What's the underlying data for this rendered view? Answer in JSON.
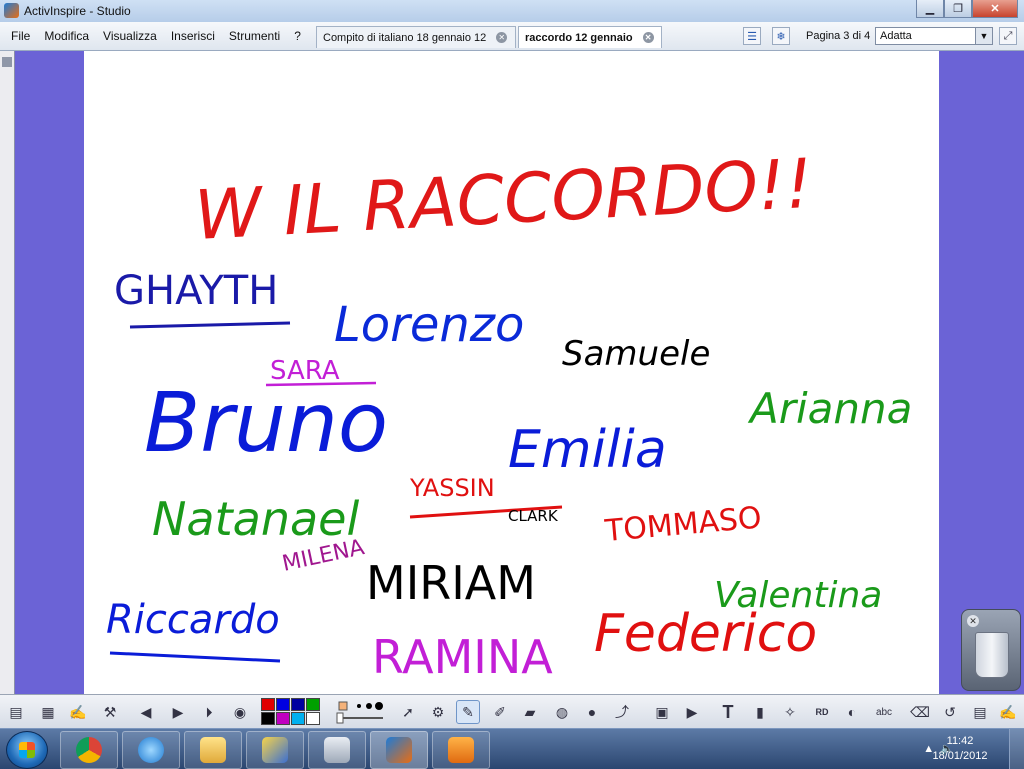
{
  "window": {
    "title": "ActivInspire - Studio",
    "controls": [
      "minimize",
      "maximize",
      "close"
    ]
  },
  "menu": [
    "File",
    "Modifica",
    "Visualizza",
    "Inserisci",
    "Strumenti",
    "?"
  ],
  "tabs": [
    {
      "label": "Compito di italiano 18 gennaio 12",
      "active": false
    },
    {
      "label": "raccordo 12 gennaio",
      "active": true
    }
  ],
  "page_info": "Pagina 3 di 4",
  "zoom": {
    "selected": "Adatta"
  },
  "flipchart": {
    "heading": "W IL RACCORDO!!",
    "names": [
      {
        "text": "GHAYTH",
        "color": "#1a1aa8"
      },
      {
        "text": "Lorenzo",
        "color": "#0a2ad8"
      },
      {
        "text": "Samuele",
        "color": "#000000"
      },
      {
        "text": "SARA",
        "color": "#c21fd6"
      },
      {
        "text": "Bruno",
        "color": "#0a1cd8"
      },
      {
        "text": "Emilia",
        "color": "#0a1cd8"
      },
      {
        "text": "Arianna",
        "color": "#1a9a1a"
      },
      {
        "text": "Natanael",
        "color": "#1a9a1a"
      },
      {
        "text": "YASSIN",
        "color": "#e01010"
      },
      {
        "text": "CLARK",
        "color": "#000000"
      },
      {
        "text": "TOMMASO",
        "color": "#e01010"
      },
      {
        "text": "MILENA",
        "color": "#a0178f"
      },
      {
        "text": "MIRIAM",
        "color": "#000000"
      },
      {
        "text": "Valentina",
        "color": "#1a9a1a"
      },
      {
        "text": "Riccardo",
        "color": "#0a1cd8"
      },
      {
        "text": "RAMINA",
        "color": "#c21fd6"
      },
      {
        "text": "Federico",
        "color": "#e01010"
      }
    ]
  },
  "palette": [
    "#e00000",
    "#0000e0",
    "#0000a0",
    "#00a000",
    "#000000",
    "#c000c0",
    "#00b0f0",
    "#ffffff"
  ],
  "toolbar_icons": [
    "main-menu-icon",
    "flipchart-browser-icon",
    "signature-icon",
    "tools-icon",
    "prev-page-icon",
    "next-page-icon",
    "play-icon",
    "record-icon",
    "color-palette",
    "pen-width-slider",
    "select-icon",
    "desktop-tools-icon",
    "pen-icon",
    "highlighter-icon",
    "eraser-icon",
    "fill-icon",
    "shape-icon",
    "connector-icon",
    "revealer-icon",
    "video-icon",
    "text-icon",
    "lock-icon",
    "magic-ink-icon",
    "read-icon",
    "globe-icon",
    "handwriting-icon",
    "clear-icon",
    "undo-icon",
    "page-tools-icon",
    "dual-user-icon"
  ],
  "taskbar": {
    "apps": [
      "chrome",
      "internet-explorer",
      "explorer",
      "paint",
      "calculator",
      "activinspire",
      "media"
    ],
    "time": "11:42",
    "date": "18/01/2012"
  }
}
